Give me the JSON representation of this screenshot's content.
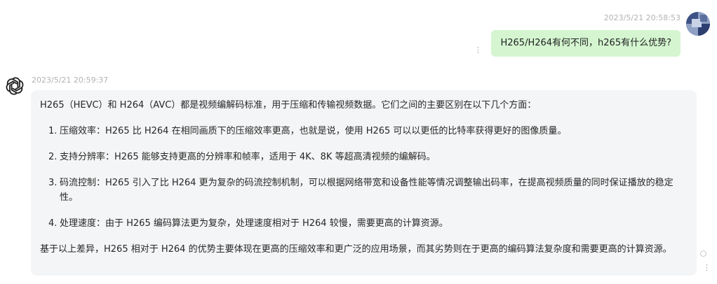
{
  "user_message": {
    "timestamp": "2023/5/21 20:58:53",
    "text": "H265/H264有何不同，h265有什么优势?",
    "more_icon": "⋮",
    "avatar_icon": "user-avatar"
  },
  "bot_message": {
    "timestamp": "2023/5/21 20:59:37",
    "avatar_icon": "openai-logo",
    "intro": "H265（HEVC）和 H264（AVC）都是视频编解码标准，用于压缩和传输视频数据。它们之间的主要区别在以下几个方面：",
    "points": [
      {
        "num": "1.",
        "text": "压缩效率：H265 比 H264 在相同画质下的压缩效率更高，也就是说，使用 H265 可以以更低的比特率获得更好的图像质量。"
      },
      {
        "num": "2.",
        "text": "支持分辨率：H265 能够支持更高的分辨率和帧率，适用于 4K、8K 等超高清视频的编解码。"
      },
      {
        "num": "3.",
        "text": "码流控制：H265 引入了比 H264 更为复杂的码流控制机制，可以根据网络带宽和设备性能等情况调整输出码率，在提高视频质量的同时保证播放的稳定性。"
      },
      {
        "num": "4.",
        "text": "处理速度：由于 H265 编码算法更为复杂，处理速度相对于 H264 较慢，需要更高的计算资源。"
      }
    ],
    "conclusion": "基于以上差异，H265 相对于 H264 的优势主要体现在更高的压缩效率和更广泛的应用场景，而其劣势则在于更高的编码算法复杂度和需要更高的计算资源。",
    "more_icon": "⋮"
  },
  "colors": {
    "user_bubble": "#d4f5d0",
    "bot_bubble": "#f4f5f6",
    "timestamp": "#b3b3b3"
  }
}
